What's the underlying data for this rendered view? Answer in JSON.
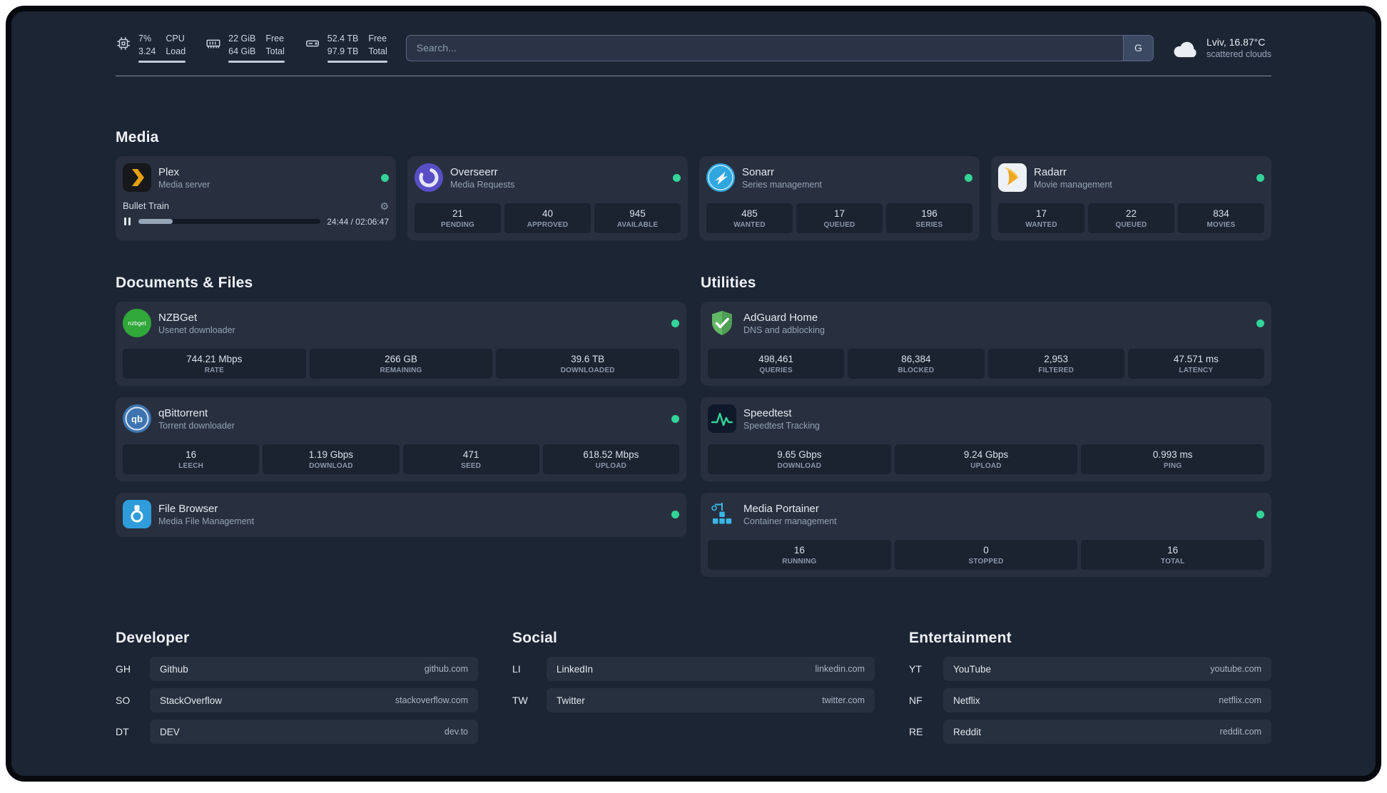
{
  "topbar": {
    "resources": [
      {
        "icon": "cpu-icon",
        "value_top": "7%",
        "value_bottom": "3.24",
        "label_top": "CPU",
        "label_bottom": "Load"
      },
      {
        "icon": "memory-icon",
        "value_top": "22 GiB",
        "value_bottom": "64 GiB",
        "label_top": "Free",
        "label_bottom": "Total"
      },
      {
        "icon": "disk-icon",
        "value_top": "52.4 TB",
        "value_bottom": "97.9 TB",
        "label_top": "Free",
        "label_bottom": "Total"
      }
    ],
    "search": {
      "placeholder": "Search...",
      "provider_button": "G"
    },
    "weather": {
      "location": "Lviv, 16.87°C",
      "condition": "scattered clouds"
    }
  },
  "sections": {
    "media": {
      "title": "Media",
      "services": [
        {
          "name": "Plex",
          "subtitle": "Media server",
          "status": "online",
          "now_playing": {
            "title": "Bullet Train",
            "elapsed": "24:44 / 02:06:47"
          }
        },
        {
          "name": "Overseerr",
          "subtitle": "Media Requests",
          "status": "online",
          "stats": [
            {
              "value": "21",
              "label": "PENDING"
            },
            {
              "value": "40",
              "label": "APPROVED"
            },
            {
              "value": "945",
              "label": "AVAILABLE"
            }
          ]
        },
        {
          "name": "Sonarr",
          "subtitle": "Series management",
          "status": "online",
          "stats": [
            {
              "value": "485",
              "label": "WANTED"
            },
            {
              "value": "17",
              "label": "QUEUED"
            },
            {
              "value": "196",
              "label": "SERIES"
            }
          ]
        },
        {
          "name": "Radarr",
          "subtitle": "Movie management",
          "status": "online",
          "stats": [
            {
              "value": "17",
              "label": "WANTED"
            },
            {
              "value": "22",
              "label": "QUEUED"
            },
            {
              "value": "834",
              "label": "MOVIES"
            }
          ]
        }
      ]
    },
    "documents": {
      "title": "Documents & Files",
      "services": [
        {
          "name": "NZBGet",
          "subtitle": "Usenet downloader",
          "status": "online",
          "stats": [
            {
              "value": "744.21 Mbps",
              "label": "RATE"
            },
            {
              "value": "266 GB",
              "label": "REMAINING"
            },
            {
              "value": "39.6 TB",
              "label": "DOWNLOADED"
            }
          ]
        },
        {
          "name": "qBittorrent",
          "subtitle": "Torrent downloader",
          "status": "online",
          "stats": [
            {
              "value": "16",
              "label": "LEECH"
            },
            {
              "value": "1.19 Gbps",
              "label": "DOWNLOAD"
            },
            {
              "value": "471",
              "label": "SEED"
            },
            {
              "value": "618.52 Mbps",
              "label": "UPLOAD"
            }
          ]
        },
        {
          "name": "File Browser",
          "subtitle": "Media File Management",
          "status": "online",
          "stats": []
        }
      ]
    },
    "utilities": {
      "title": "Utilities",
      "services": [
        {
          "name": "AdGuard Home",
          "subtitle": "DNS and adblocking",
          "status": "online",
          "stats": [
            {
              "value": "498,461",
              "label": "QUERIES"
            },
            {
              "value": "86,384",
              "label": "BLOCKED"
            },
            {
              "value": "2,953",
              "label": "FILTERED"
            },
            {
              "value": "47.571 ms",
              "label": "LATENCY"
            }
          ]
        },
        {
          "name": "Speedtest",
          "subtitle": "Speedtest Tracking",
          "status": "online",
          "stats": [
            {
              "value": "9.65 Gbps",
              "label": "DOWNLOAD"
            },
            {
              "value": "9.24 Gbps",
              "label": "UPLOAD"
            },
            {
              "value": "0.993 ms",
              "label": "PING"
            }
          ]
        },
        {
          "name": "Media Portainer",
          "subtitle": "Container management",
          "status": "online",
          "stats": [
            {
              "value": "16",
              "label": "RUNNING"
            },
            {
              "value": "0",
              "label": "STOPPED"
            },
            {
              "value": "16",
              "label": "TOTAL"
            }
          ]
        }
      ]
    }
  },
  "bookmarks": {
    "groups": [
      {
        "title": "Developer",
        "items": [
          {
            "abbr": "GH",
            "name": "Github",
            "url": "github.com"
          },
          {
            "abbr": "SO",
            "name": "StackOverflow",
            "url": "stackoverflow.com"
          },
          {
            "abbr": "DT",
            "name": "DEV",
            "url": "dev.to"
          }
        ]
      },
      {
        "title": "Social",
        "items": [
          {
            "abbr": "LI",
            "name": "LinkedIn",
            "url": "linkedin.com"
          },
          {
            "abbr": "TW",
            "name": "Twitter",
            "url": "twitter.com"
          }
        ]
      },
      {
        "title": "Entertainment",
        "items": [
          {
            "abbr": "YT",
            "name": "YouTube",
            "url": "youtube.com"
          },
          {
            "abbr": "NF",
            "name": "Netflix",
            "url": "netflix.com"
          },
          {
            "abbr": "RE",
            "name": "Reddit",
            "url": "reddit.com"
          }
        ]
      }
    ]
  },
  "colors": {
    "status_online": "#34d399",
    "page_background": "#1c2534"
  }
}
